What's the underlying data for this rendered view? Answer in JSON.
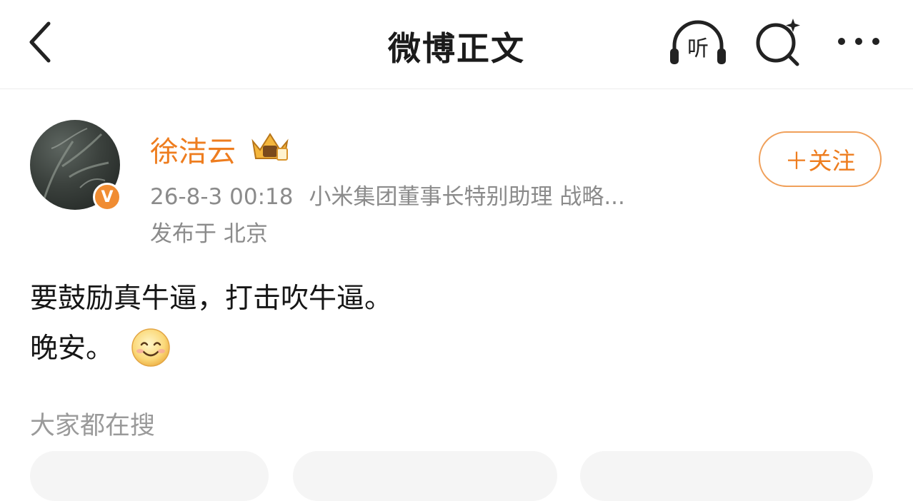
{
  "header": {
    "title": "微博正文",
    "listen_label": "听",
    "icons": [
      "back-arrow-icon",
      "headphones-listen-icon",
      "search-sparkle-icon",
      "more-dots-icon"
    ]
  },
  "post": {
    "author": "徐洁云",
    "verified_badge": "V",
    "timestamp": "26-8-3 00:18",
    "author_title": "小米集团董事长特别助理 战略...",
    "location": "发布于 北京",
    "follow_label": "＋关注",
    "content_lines": [
      "要鼓励真牛逼，打击吹牛逼。",
      "晚安。"
    ]
  },
  "hot_search": {
    "title": "大家都在搜"
  },
  "colors": {
    "accent": "#ee7d1f",
    "follow_border": "#f0a05a",
    "meta_text": "#8b8b8b",
    "badge": "#f08c32"
  }
}
